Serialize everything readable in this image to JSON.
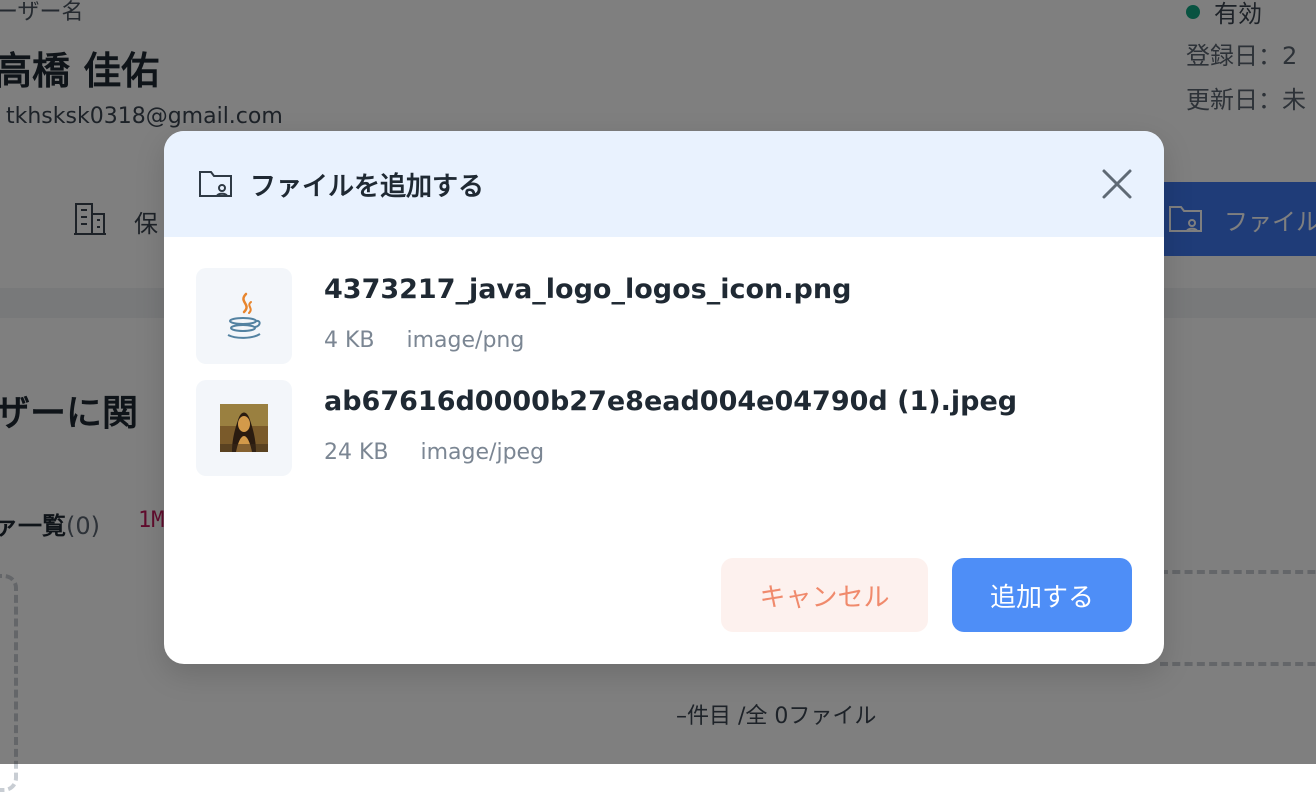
{
  "background": {
    "user_label": "ーザー名",
    "user_name": "高橋 佳佑",
    "user_email": "tkhsksk0318@gmail.com",
    "status_text": "有効",
    "registered_label": "登録日：2",
    "updated_label": "更新日：未",
    "tab_label": "保",
    "files_tab_label": "ファイル",
    "section_heading": "ザーに関",
    "list_title": "ァ一覧",
    "list_count": "(0)",
    "limit_badge": "1M",
    "pagination": "–件目 /全 0ファイル"
  },
  "modal": {
    "title": "ファイルを追加する",
    "files": [
      {
        "name": "4373217_java_logo_logos_icon.png",
        "size": "4 KB",
        "type": "image/png",
        "thumb_icon": "java-logo-icon"
      },
      {
        "name": "ab67616d0000b27e8ead004e04790d (1).jpeg",
        "size": "24 KB",
        "type": "image/jpeg",
        "thumb_icon": "portrait-image-icon"
      }
    ],
    "cancel_label": "キャンセル",
    "add_label": "追加する"
  },
  "colors": {
    "accent": "#4e8ef7",
    "header_bg": "#e9f2fe",
    "cancel_bg": "#fdf1ee",
    "cancel_text": "#f08a6c",
    "status_green": "#11a683"
  }
}
